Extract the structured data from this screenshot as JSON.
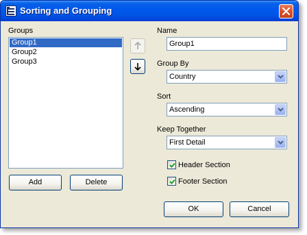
{
  "window": {
    "title": "Sorting and Grouping"
  },
  "groups": {
    "label": "Groups",
    "items": [
      "Group1",
      "Group2",
      "Group3"
    ],
    "selected_index": 0,
    "add_label": "Add",
    "delete_label": "Delete"
  },
  "name": {
    "label": "Name",
    "value": "Group1"
  },
  "group_by": {
    "label": "Group By",
    "value": "Country"
  },
  "sort": {
    "label": "Sort",
    "value": "Ascending"
  },
  "keep_together": {
    "label": "Keep Together",
    "value": "First Detail"
  },
  "header_section": {
    "label": "Header Section",
    "checked": true
  },
  "footer_section": {
    "label": "Footer Section",
    "checked": true
  },
  "footer": {
    "ok_label": "OK",
    "cancel_label": "Cancel"
  },
  "icons": {
    "app": "report-grouping-icon",
    "close": "close-icon",
    "move_up": "arrow-up-icon",
    "move_down": "arrow-down-icon",
    "dropdown": "chevron-down-icon",
    "check": "checkmark-icon"
  },
  "colors": {
    "titlebar": "#0058ee",
    "selection": "#316ac5",
    "dialog_bg": "#ece9d8",
    "check": "#21a121"
  }
}
